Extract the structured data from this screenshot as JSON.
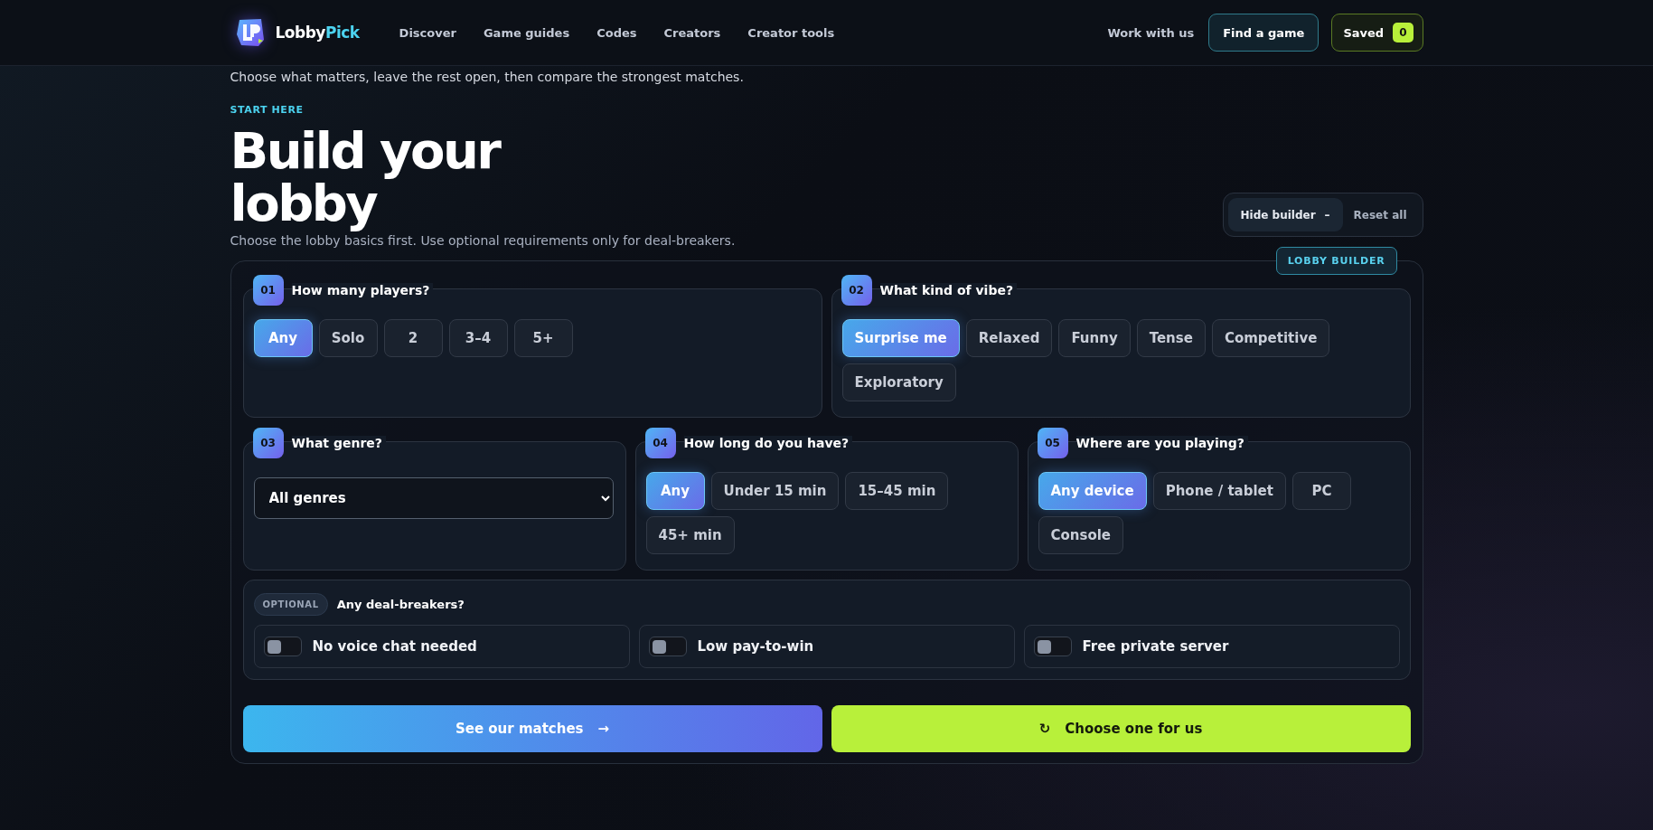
{
  "header": {
    "brand": {
      "part_1": "Lobby",
      "part_2": "Pick"
    },
    "nav": [
      {
        "label": "Discover"
      },
      {
        "label": "Game guides"
      },
      {
        "label": "Codes"
      },
      {
        "label": "Creators"
      },
      {
        "label": "Creator tools"
      }
    ],
    "work_link": "Work with us",
    "find_button": "Find a game",
    "saved_button": {
      "label": "Saved",
      "count": "0"
    }
  },
  "intro": "Choose what matters, leave the rest open, then compare the strongest matches.",
  "eyebrow": "START HERE",
  "title": "Build your lobby",
  "subtitle": "Choose the lobby basics first. Use optional requirements only for deal-breakers.",
  "builder_controls": {
    "hide": {
      "label": "Hide builder",
      "icon": "–"
    },
    "reset": "Reset all"
  },
  "builder_badge": "LOBBY BUILDER",
  "steps": [
    {
      "kind": "chips",
      "number": "01",
      "question": "How many players?",
      "options": [
        {
          "label": "Any",
          "selected": true
        },
        {
          "label": "Solo",
          "selected": false
        },
        {
          "label": "2",
          "selected": false
        },
        {
          "label": "3–4",
          "selected": false
        },
        {
          "label": "5+",
          "selected": false
        }
      ]
    },
    {
      "kind": "chips",
      "number": "02",
      "question": "What kind of vibe?",
      "options": [
        {
          "label": "Surprise me",
          "selected": true
        },
        {
          "label": "Relaxed",
          "selected": false
        },
        {
          "label": "Funny",
          "selected": false
        },
        {
          "label": "Tense",
          "selected": false
        },
        {
          "label": "Competitive",
          "selected": false
        },
        {
          "label": "Exploratory",
          "selected": false
        }
      ]
    },
    {
      "kind": "select",
      "number": "03",
      "question": "What genre?",
      "value": "All genres"
    },
    {
      "kind": "chips",
      "number": "04",
      "question": "How long do you have?",
      "options": [
        {
          "label": "Any",
          "selected": true
        },
        {
          "label": "Under 15 min",
          "selected": false
        },
        {
          "label": "15–45 min",
          "selected": false
        },
        {
          "label": "45+ min",
          "selected": false
        }
      ]
    },
    {
      "kind": "chips",
      "number": "05",
      "question": "Where are you playing?",
      "options": [
        {
          "label": "Any device",
          "selected": true
        },
        {
          "label": "Phone / tablet",
          "selected": false
        },
        {
          "label": "PC",
          "selected": false
        },
        {
          "label": "Console",
          "selected": false
        }
      ]
    }
  ],
  "optional": {
    "tag": "OPTIONAL",
    "question": "Any deal-breakers?",
    "toggles": [
      {
        "label": "No voice chat needed",
        "on": false
      },
      {
        "label": "Low pay-to-win",
        "on": false
      },
      {
        "label": "Free private server",
        "on": false
      }
    ]
  },
  "actions": {
    "matches": {
      "label": "See our matches",
      "icon": "→"
    },
    "choose": {
      "label": "Choose one for us",
      "icon": "↻"
    }
  }
}
